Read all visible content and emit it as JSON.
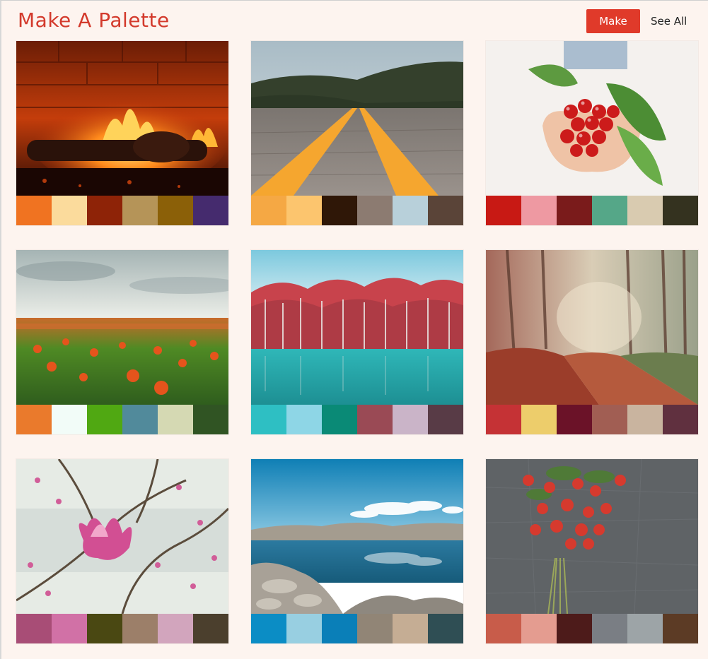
{
  "header": {
    "title": "Make A Palette",
    "make_label": "Make",
    "see_all_label": "See All",
    "accent": "#e03a2a"
  },
  "palettes": [
    {
      "scene": "fireplace",
      "colors": [
        "#f07321",
        "#fbdb9c",
        "#8e2307",
        "#b59458",
        "#8b6008",
        "#452b6e"
      ]
    },
    {
      "scene": "road",
      "colors": [
        "#f5a844",
        "#fcc56e",
        "#2f1707",
        "#8c7b71",
        "#b8d0da",
        "#5a4438"
      ]
    },
    {
      "scene": "cherries",
      "colors": [
        "#c81914",
        "#ee99a2",
        "#7a1b1b",
        "#55a788",
        "#d9cbb0",
        "#34321f"
      ]
    },
    {
      "scene": "poppies",
      "colors": [
        "#ea7a2c",
        "#f2fcf8",
        "#50a812",
        "#518a9b",
        "#d5d9b3",
        "#305423"
      ]
    },
    {
      "scene": "lake-trees",
      "colors": [
        "#2ebfc3",
        "#8ed6e6",
        "#0a8a76",
        "#9a4a55",
        "#cab4c8",
        "#583b46"
      ]
    },
    {
      "scene": "forest",
      "colors": [
        "#c53235",
        "#edcd6b",
        "#6b1228",
        "#a15e53",
        "#c9b49f",
        "#60303f"
      ]
    },
    {
      "scene": "magnolia",
      "colors": [
        "#a84d76",
        "#d171a6",
        "#4a4812",
        "#9c7f69",
        "#d2a5bd",
        "#4b3f2d"
      ]
    },
    {
      "scene": "lake-rocks",
      "colors": [
        "#0b8dc5",
        "#98cfe1",
        "#0a7fb8",
        "#918576",
        "#c5ad94",
        "#2f4e54"
      ]
    },
    {
      "scene": "strawberries",
      "colors": [
        "#c85c4a",
        "#e49c90",
        "#4d1b1a",
        "#7a7e84",
        "#9da4a7",
        "#5c3b25"
      ]
    }
  ]
}
